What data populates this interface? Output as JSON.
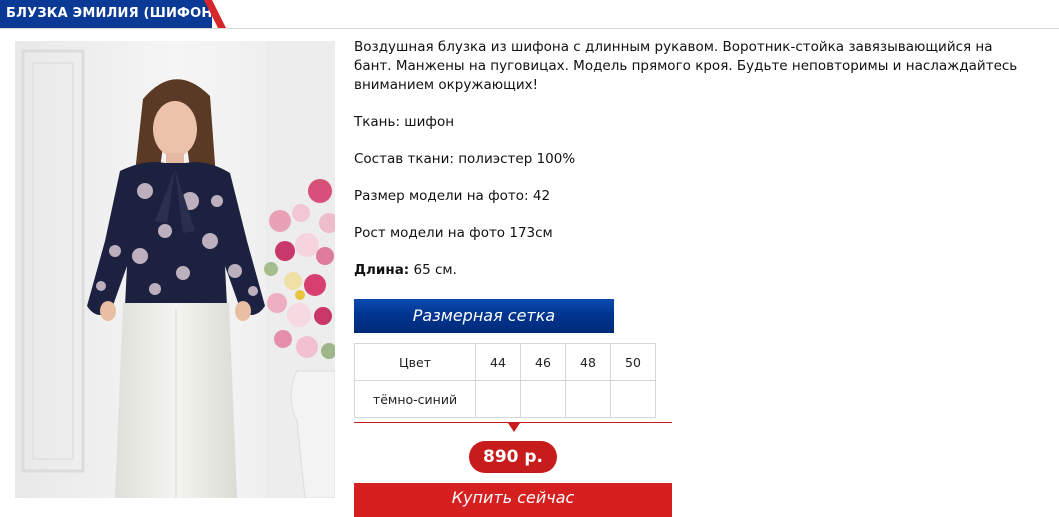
{
  "product": {
    "title": "БЛУЗКА ЭМИЛИЯ (ШИФОН)",
    "description": "Воздушная блузка из шифона с длинным рукавом. Воротник-стойка завязывающийся на бант. Манжены на пуговицах. Модель прямого кроя. Будьте неповторимы и наслаждайтесь вниманием окружающих!",
    "fabric": "Ткань: шифон",
    "composition": "Состав ткани: полиэстер 100%",
    "model_size": "Размер модели на фото: 42",
    "model_height": "Рост модели на фото 173см",
    "length_label": "Длина:",
    "length_value": "65 см."
  },
  "size_chart_button": "Размерная сетка",
  "size_table": {
    "header": {
      "color": "Цвет",
      "sizes": [
        "44",
        "46",
        "48",
        "50"
      ]
    },
    "rows": [
      {
        "color": "тёмно-синий"
      }
    ]
  },
  "price": "890 р.",
  "buy_button": "Купить сейчас",
  "colors": {
    "brand_blue": "#0a3a96",
    "price_red": "#c81b1b",
    "stripe_red": "#d8262c"
  }
}
